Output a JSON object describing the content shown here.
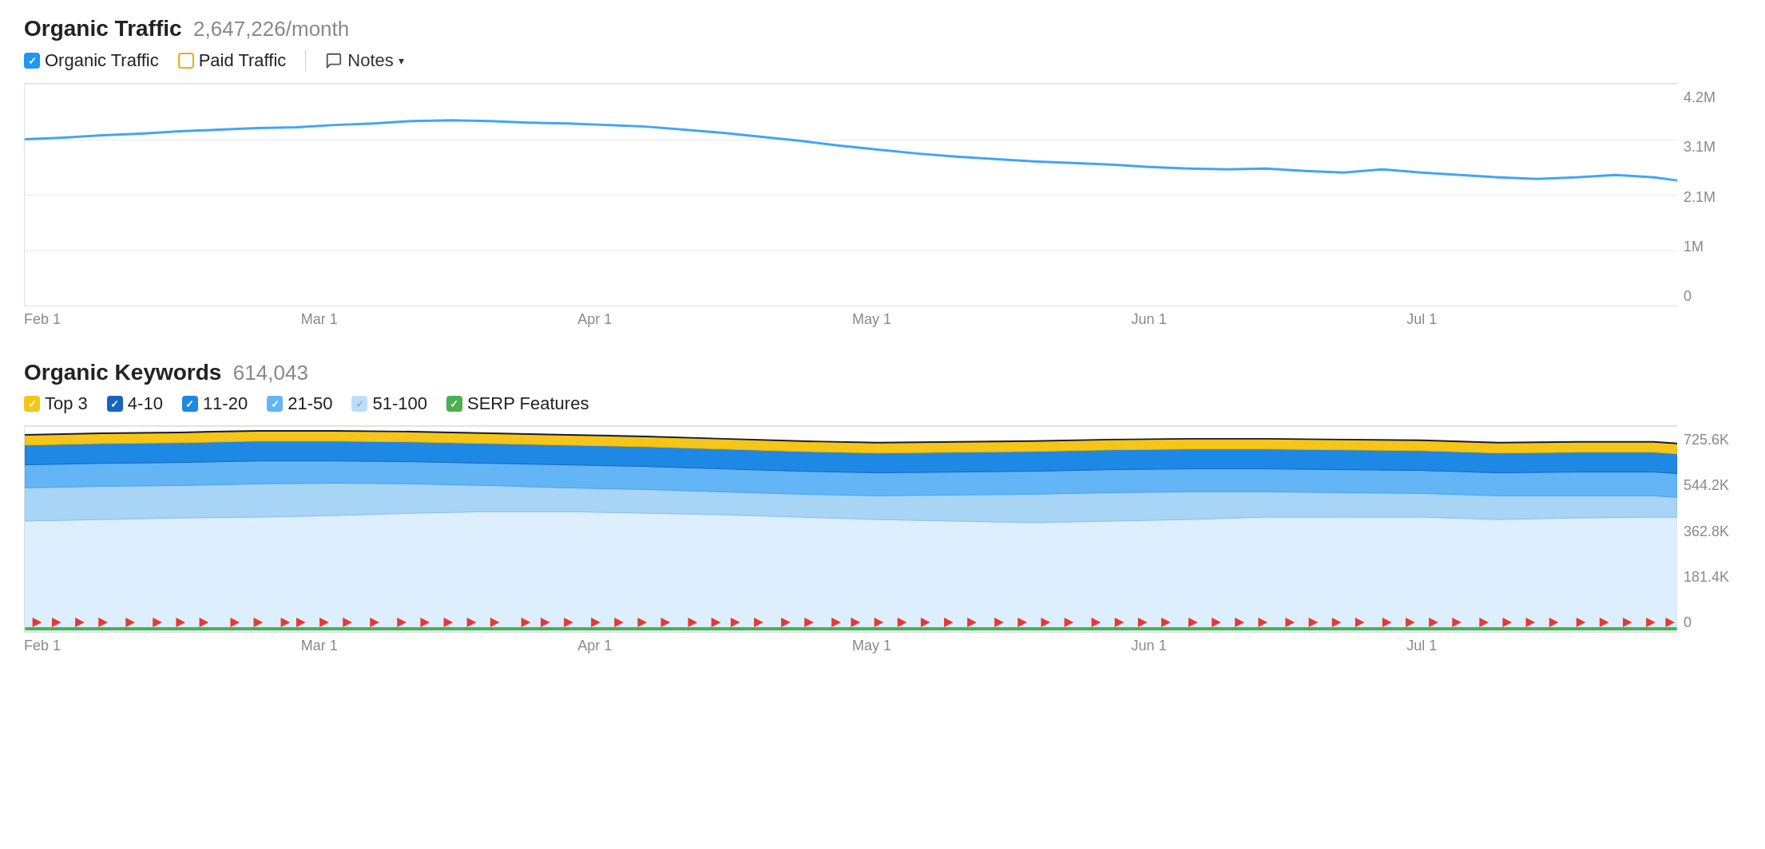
{
  "organic_traffic": {
    "title": "Organic Traffic",
    "value": "2,647,226/month",
    "legend": [
      {
        "key": "organic-traffic",
        "label": "Organic Traffic",
        "checkbox_type": "blue",
        "checked": true
      },
      {
        "key": "paid-traffic",
        "label": "Paid Traffic",
        "checkbox_type": "orange-outline",
        "checked": false
      }
    ],
    "notes_label": "Notes",
    "y_axis_labels": [
      "4.2M",
      "3.1M",
      "2.1M",
      "1M",
      "0"
    ],
    "x_axis_labels": [
      "Feb 1",
      "Mar 1",
      "Apr 1",
      "May 1",
      "Jun 1",
      "Jul 1",
      ""
    ]
  },
  "organic_keywords": {
    "title": "Organic Keywords",
    "value": "614,043",
    "legend": [
      {
        "key": "top3",
        "label": "Top 3",
        "checkbox_type": "yellow",
        "checked": true
      },
      {
        "key": "4-10",
        "label": "4-10",
        "checkbox_type": "dark-blue",
        "checked": true
      },
      {
        "key": "11-20",
        "label": "11-20",
        "checkbox_type": "mid-blue",
        "checked": true
      },
      {
        "key": "21-50",
        "label": "21-50",
        "checkbox_type": "light-blue2",
        "checked": true
      },
      {
        "key": "51-100",
        "label": "51-100",
        "checkbox_type": "very-light-blue",
        "checked": true
      },
      {
        "key": "serp",
        "label": "SERP Features",
        "checkbox_type": "green",
        "checked": true
      }
    ],
    "y_axis_labels": [
      "725.6K",
      "544.2K",
      "362.8K",
      "181.4K",
      "0"
    ],
    "x_axis_labels": [
      "Feb 1",
      "Mar 1",
      "Apr 1",
      "May 1",
      "Jun 1",
      "Jul 1",
      ""
    ]
  }
}
